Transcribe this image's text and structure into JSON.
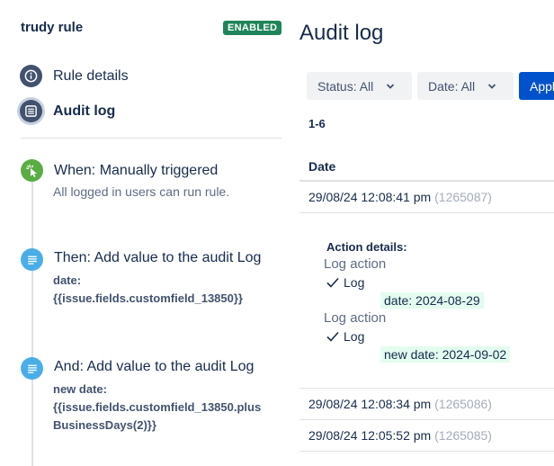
{
  "sidebar": {
    "rule_name": "trudy rule",
    "status_badge": "ENABLED",
    "nav": [
      {
        "label": "Rule details",
        "icon": "info-icon"
      },
      {
        "label": "Audit log",
        "icon": "list-icon"
      }
    ],
    "steps": [
      {
        "title": "When: Manually triggered",
        "subtitle": "All logged in users can run rule.",
        "icon": "cursor-click-icon"
      },
      {
        "title": "Then: Add value to the audit Log",
        "detail_lines": [
          "date:",
          "{{issue.fields.customfield_13850}}"
        ],
        "icon": "document-icon"
      },
      {
        "title": "And: Add value to the audit Log",
        "detail_lines": [
          "new date:",
          "{{issue.fields.customfield_13850.plus",
          "BusinessDays(2)}}"
        ],
        "icon": "document-icon"
      }
    ]
  },
  "main": {
    "title": "Audit log",
    "filters": [
      {
        "label": "Status: All"
      },
      {
        "label": "Date: All"
      }
    ],
    "apply_label": "Apply",
    "count": "1-6",
    "table_header": "Date",
    "rows": [
      {
        "date": "29/08/24 12:08:41 pm",
        "id": "(1265087)"
      },
      {
        "date": "29/08/24 12:08:34 pm",
        "id": "(1265086)"
      },
      {
        "date": "29/08/24 12:05:52 pm",
        "id": "(1265085)"
      }
    ],
    "expanded": {
      "heading": "Action details:",
      "entries": [
        {
          "action": "Log action",
          "check": "Log",
          "value": "date: 2024-08-29"
        },
        {
          "action": "Log action",
          "check": "Log",
          "value": "new date: 2024-09-02"
        }
      ]
    }
  },
  "colors": {
    "badge_green": "#1f845a",
    "nav_icon": "#42526e",
    "trigger_green": "#5aac44",
    "action_blue": "#4bade8",
    "primary_blue": "#0052cc",
    "highlight_green": "#e3fcef"
  }
}
